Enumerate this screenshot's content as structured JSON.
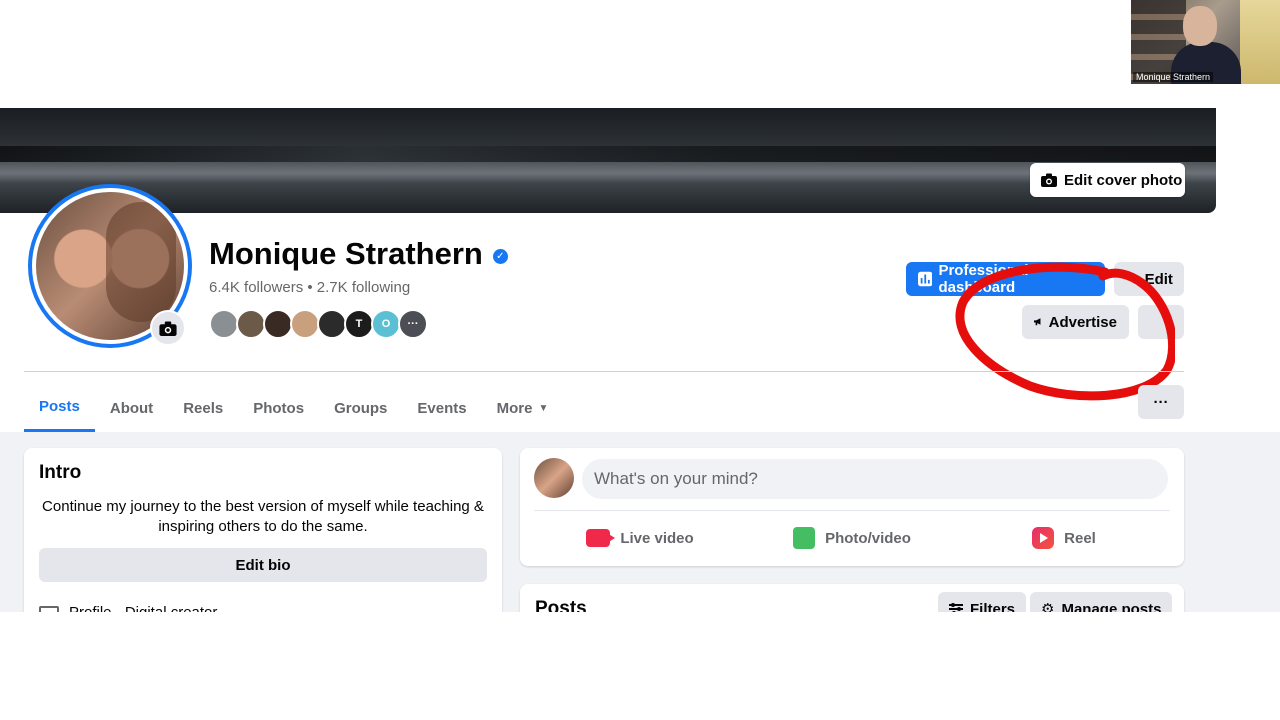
{
  "webcam": {
    "participant_name": "Monique Strathern"
  },
  "cover": {
    "edit_label": "Edit cover photo"
  },
  "profile": {
    "name": "Monique Strathern",
    "stats": "6.4K followers • 2.7K following",
    "friends": [
      {
        "color": "#8a8f94",
        "label": ""
      },
      {
        "color": "#6c5a48",
        "label": ""
      },
      {
        "color": "#3a2a24",
        "label": ""
      },
      {
        "color": "#c9a07e",
        "label": ""
      },
      {
        "color": "#2b2b2b",
        "label": ""
      },
      {
        "color": "#1c1c1c",
        "label": "T"
      },
      {
        "color": "#5bc0d3",
        "label": "O"
      },
      {
        "color": "#4b4f55",
        "label": "···"
      }
    ]
  },
  "actions": {
    "professional_dashboard": "Professional dashboard",
    "edit": "Edit",
    "advertise": "Advertise",
    "more": "···"
  },
  "tabs": [
    {
      "label": "Posts",
      "active": true
    },
    {
      "label": "About"
    },
    {
      "label": "Reels"
    },
    {
      "label": "Photos"
    },
    {
      "label": "Groups"
    },
    {
      "label": "Events"
    },
    {
      "label": "More"
    }
  ],
  "intro": {
    "title": "Intro",
    "bio": "Continue my journey to the best version of myself while teaching & inspiring others to do the same.",
    "edit_bio": "Edit bio",
    "profile_row": "Profile · Digital creator"
  },
  "composer": {
    "placeholder": "What's on your mind?",
    "live": "Live video",
    "photo": "Photo/video",
    "reel": "Reel"
  },
  "posts": {
    "title": "Posts",
    "filters": "Filters",
    "manage": "Manage posts"
  },
  "colors": {
    "accent": "#1877f2",
    "annotation": "#e60d0d"
  }
}
